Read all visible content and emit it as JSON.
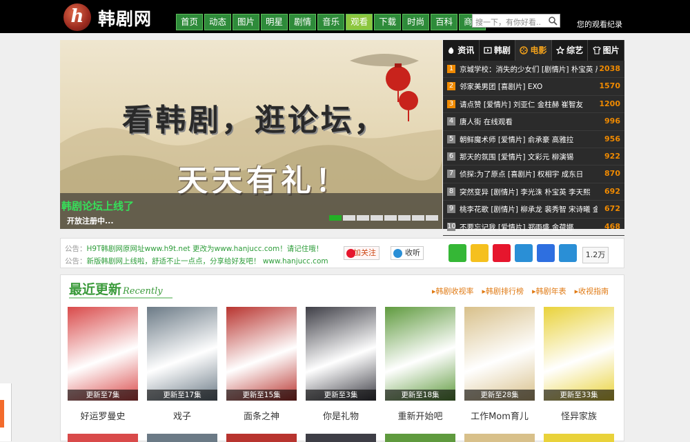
{
  "header": {
    "logo_letter": "h",
    "site_name": "韩剧网",
    "nav": [
      {
        "label": "首页",
        "active": false
      },
      {
        "label": "动态",
        "active": false
      },
      {
        "label": "图片",
        "active": false
      },
      {
        "label": "明星",
        "active": false
      },
      {
        "label": "剧情",
        "active": false
      },
      {
        "label": "音乐",
        "active": false
      },
      {
        "label": "观看",
        "active": true
      },
      {
        "label": "下载",
        "active": false
      },
      {
        "label": "时尚",
        "active": false
      },
      {
        "label": "百科",
        "active": false
      },
      {
        "label": "商城",
        "active": false
      }
    ],
    "search_placeholder": "搜一下，有你好看..",
    "history_link": "您的观看纪录"
  },
  "banner": {
    "headline": "看韩剧，逛论坛，",
    "subline": "天天有礼！",
    "caption_title": "韩剧论坛上线了",
    "caption_sub": "开放注册中...",
    "slide_count": 8,
    "active_slide": 1
  },
  "ranking": {
    "tabs": [
      {
        "label": "资讯",
        "icon": "fire-icon",
        "active": false
      },
      {
        "label": "韩剧",
        "icon": "play-icon",
        "active": false
      },
      {
        "label": "电影",
        "icon": "film-icon",
        "active": true
      },
      {
        "label": "综艺",
        "icon": "star-icon",
        "active": false
      },
      {
        "label": "图片",
        "icon": "shirt-icon",
        "active": false
      }
    ],
    "items": [
      {
        "rank": "1",
        "title": "京城学校：消失的少女们 [剧情片] 朴宝英 严",
        "count": "2038"
      },
      {
        "rank": "2",
        "title": "邻家美男团 [喜剧片] EXO",
        "count": "1570"
      },
      {
        "rank": "3",
        "title": "请点赞 [爱情片] 刘亚仁 金柱赫 崔智友",
        "count": "1200"
      },
      {
        "rank": "4",
        "title": "唐人街 在线观看",
        "count": "996"
      },
      {
        "rank": "5",
        "title": "朝鲜魔术师 [爱情片] 俞承豪 高雅拉",
        "count": "956"
      },
      {
        "rank": "6",
        "title": "那天的氛围 [爱情片] 文彩元 柳演锡",
        "count": "922"
      },
      {
        "rank": "7",
        "title": "侦探:为了原点 [喜剧片] 权相宇 成东日",
        "count": "870"
      },
      {
        "rank": "8",
        "title": "突然变异 [剧情片] 李光洙 朴宝英 李天熙",
        "count": "692"
      },
      {
        "rank": "9",
        "title": "桃李花歌 [剧情片] 柳承龙 裴秀智 宋诗曦 金南佶",
        "count": "672"
      },
      {
        "rank": "10",
        "title": "不要忘记我 [爱情片] 郑雨盛 金荷娜",
        "count": "468"
      }
    ]
  },
  "notice": {
    "line1_prefix": "公告：",
    "line1_text": "H9T韩剧网原网址www.h9t.net 更改为www.hanjucc.com！请记住哦！",
    "line2_prefix": "公告：",
    "line2_text": "新版韩剧网上线啦，舒适不止一点点，分享给好友吧！ www.hanjucc.com",
    "follow_label": "加关注",
    "listen_label": "收听",
    "share_count": "1.2万",
    "shares": [
      "wechat-icon",
      "qzone-icon",
      "weibo-icon",
      "tencent-weibo-icon",
      "baidu-icon",
      "more-share-icon"
    ]
  },
  "recent": {
    "title": "最近更新",
    "title_en": "Recently",
    "links": [
      "韩剧收视率",
      "韩剧排行榜",
      "韩剧年表",
      "收视指南"
    ],
    "posters": [
      {
        "name": "好运罗曼史",
        "update": "更新至7集",
        "color": "#d94a4a"
      },
      {
        "name": "戏子",
        "update": "更新至17集",
        "color": "#6b7a86"
      },
      {
        "name": "面条之神",
        "update": "更新至15集",
        "color": "#b8342f"
      },
      {
        "name": "你是礼物",
        "update": "更新至3集",
        "color": "#3e3e46"
      },
      {
        "name": "重新开始吧",
        "update": "更新至18集",
        "color": "#5f9a3e"
      },
      {
        "name": "工作Mom育儿",
        "update": "更新至28集",
        "color": "#d8c08a"
      },
      {
        "name": "怪异家族",
        "update": "更新至33集",
        "color": "#e9d23a"
      }
    ]
  }
}
